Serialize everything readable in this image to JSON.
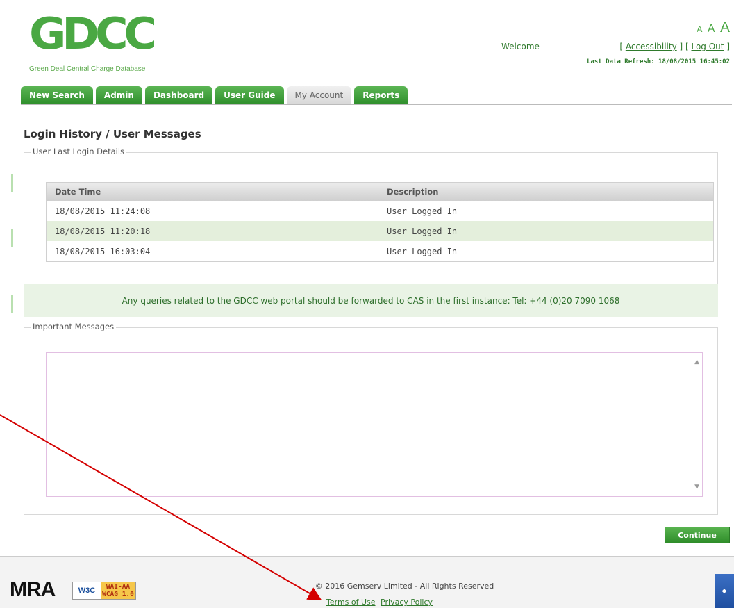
{
  "header": {
    "logo_text": "GDCC",
    "logo_subtitle": "Green Deal Central Charge Database",
    "welcome": "Welcome",
    "font_sizes": [
      "A",
      "A",
      "A"
    ],
    "accessibility_link": "Accessibility",
    "logout_link": "Log Out",
    "last_refresh": "Last Data Refresh: 18/08/2015 16:45:02"
  },
  "tabs": [
    {
      "label": "New Search"
    },
    {
      "label": "Admin"
    },
    {
      "label": "Dashboard"
    },
    {
      "label": "User Guide"
    },
    {
      "label": "My Account",
      "active": true
    },
    {
      "label": "Reports"
    }
  ],
  "page_title": "Login History / User Messages",
  "login_section": {
    "legend": "User Last Login Details",
    "columns": [
      "Date Time",
      "Description"
    ],
    "rows": [
      [
        "18/08/2015 11:24:08",
        "User Logged In"
      ],
      [
        "18/08/2015 11:20:18",
        "User Logged In"
      ],
      [
        "18/08/2015 16:03:04",
        "User Logged In"
      ]
    ]
  },
  "notice": "Any queries related to the GDCC web portal should be forwarded to CAS in the first instance: Tel: +44 (0)20 7090 1068",
  "messages_section": {
    "legend": "Important Messages",
    "content": ""
  },
  "continue_button": "Continue",
  "footer": {
    "mra": "MRA",
    "w3c": "W3C",
    "wai_line1": "WAI-AA",
    "wai_line2": "WCAG 1.0",
    "copyright": "© 2016 Gemserv Limited - All Rights Reserved",
    "terms": "Terms of Use",
    "privacy": "Privacy Policy"
  },
  "colors": {
    "brand_green": "#4aa843",
    "dark_green": "#2f7a2c",
    "annotation_arrow": "#d40000"
  }
}
